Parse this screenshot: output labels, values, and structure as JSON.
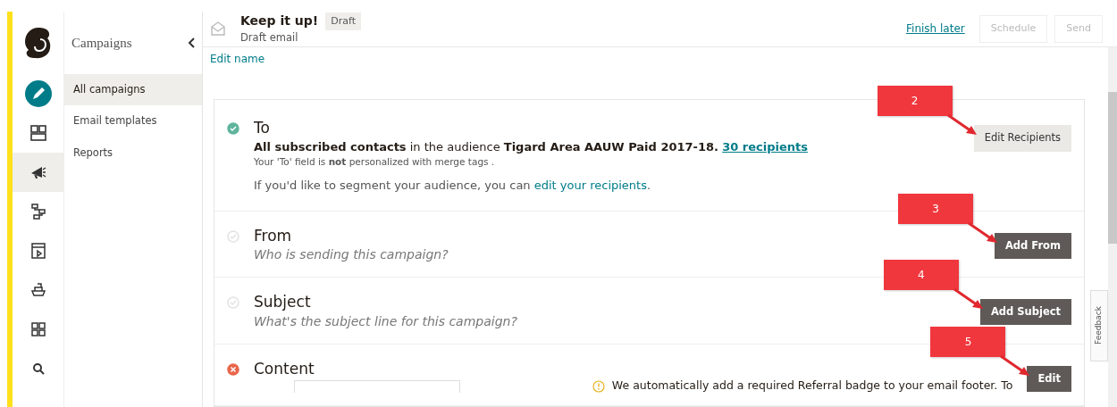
{
  "rail": {
    "items": [
      {
        "selected": false
      },
      {
        "selected": false
      },
      {
        "selected": true
      },
      {
        "selected": false
      },
      {
        "selected": false
      },
      {
        "selected": false
      },
      {
        "selected": false
      },
      {
        "selected": false
      }
    ]
  },
  "sidebar": {
    "title": "Campaigns",
    "items": [
      {
        "label": "All campaigns",
        "selected": true
      },
      {
        "label": "Email templates",
        "selected": false
      },
      {
        "label": "Reports",
        "selected": false
      }
    ]
  },
  "header": {
    "title": "Keep it up!",
    "badge": "Draft",
    "subtitle": "Draft email",
    "finish_link": "Finish later",
    "buttons": [
      {
        "label": "Schedule",
        "disabled": true
      },
      {
        "label": "Send",
        "disabled": true
      }
    ]
  },
  "edit_name": "Edit name",
  "sections": [
    {
      "title": "To",
      "kind": "complete",
      "summary": "**All subscribed contacts** in the audience **Tigard Area AAUW Paid 2017-18.**",
      "summary_link": "30 recipients",
      "note": "Your 'To' field is **not** personalized with merge tags .",
      "hint": "If you'd like to segment your audience, you can ",
      "hint_link": "edit your recipients",
      "hint_end": ".",
      "button": {
        "label": "Edit Recipients",
        "kind": "light"
      },
      "annotation": "2"
    },
    {
      "title": "From",
      "kind": "incomplete",
      "prompt": "Who is sending this campaign?",
      "button": {
        "label": "Add From",
        "kind": "dark"
      },
      "annotation": "3"
    },
    {
      "title": "Subject",
      "kind": "incomplete",
      "prompt": "What's the subject line for this campaign?",
      "button": {
        "label": "Add Subject",
        "kind": "dark"
      },
      "annotation": "4"
    },
    {
      "title": "Content",
      "kind": "error",
      "notice": "We automatically add a required Referral badge to your email footer. To",
      "button": {
        "label": "Edit",
        "kind": "dark"
      },
      "annotation": "5"
    }
  ],
  "feedback_tab": "Feedback"
}
